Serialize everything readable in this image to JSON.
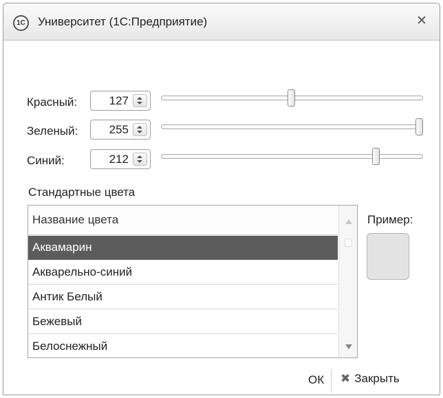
{
  "window": {
    "app_icon": "1С",
    "title": "Университет  (1С:Предприятие)",
    "close_icon": "✕"
  },
  "rgb": {
    "red": {
      "label": "Красный:",
      "value": "127",
      "fraction": 0.498
    },
    "green": {
      "label": "Зеленый:",
      "value": "255",
      "fraction": 1.0
    },
    "blue": {
      "label": "Синий:",
      "value": "212",
      "fraction": 0.831
    }
  },
  "standard_colors": {
    "label": "Стандартные цвета",
    "column_header": "Название цвета",
    "items": [
      {
        "name": "Аквамарин",
        "selected": true
      },
      {
        "name": "Акварельно-синий",
        "selected": false
      },
      {
        "name": "Антик Белый",
        "selected": false
      },
      {
        "name": "Бежевый",
        "selected": false
      },
      {
        "name": "Белоснежный",
        "selected": false
      }
    ]
  },
  "preview": {
    "label": "Пример:",
    "color": "#e3e3e3"
  },
  "buttons": {
    "ok": "ОК",
    "close": "Закрыть",
    "close_icon": "✖"
  },
  "icons": {
    "spin": "spin-up-down-icon",
    "scroll_up": "scroll-up-arrow-icon",
    "scroll_down": "scroll-down-arrow-icon"
  }
}
